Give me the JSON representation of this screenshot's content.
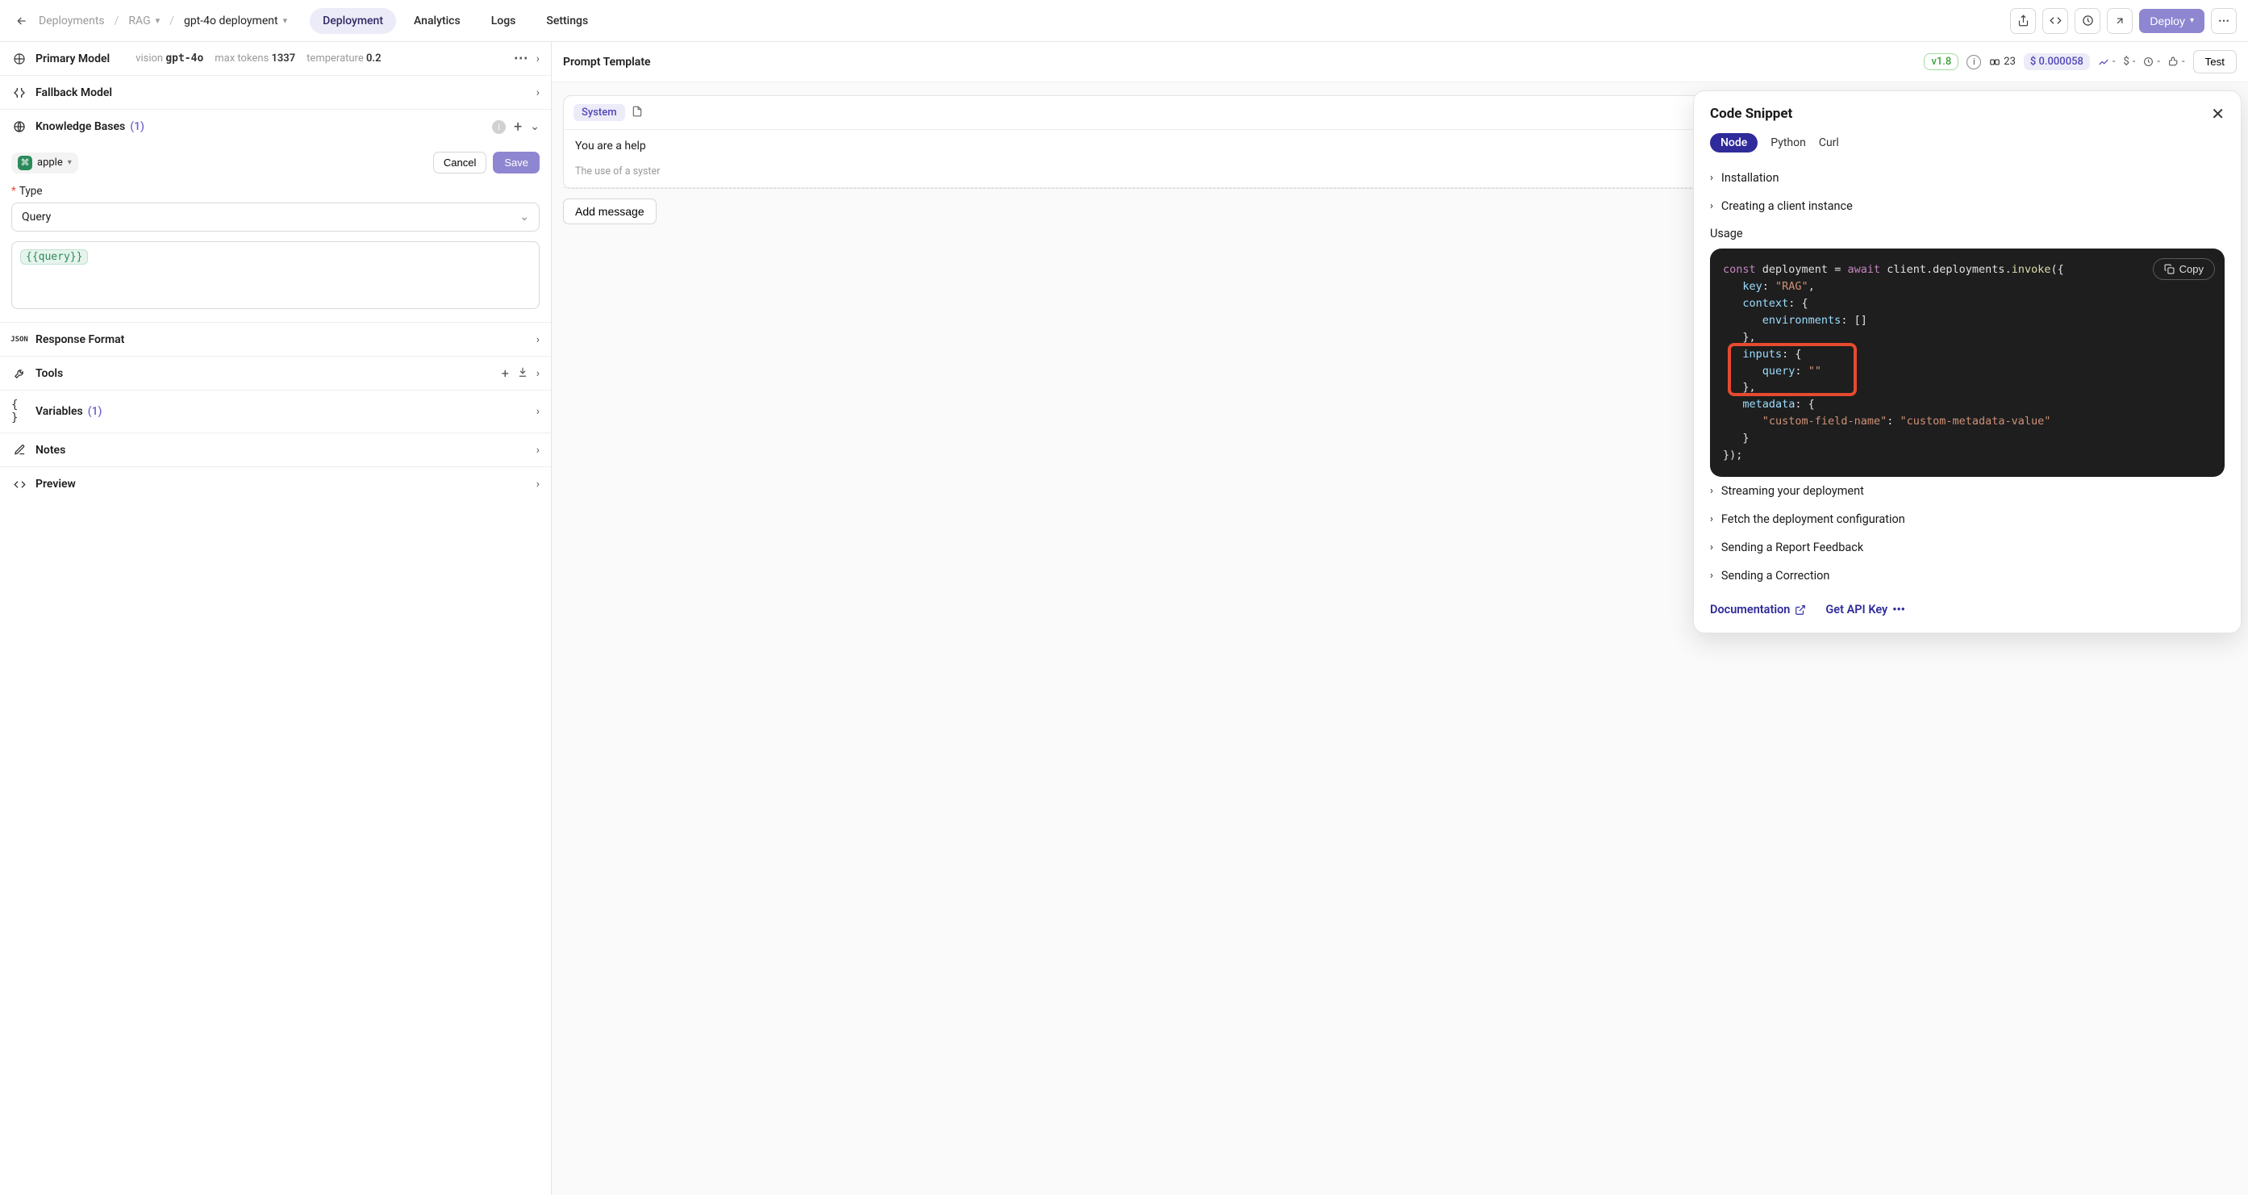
{
  "breadcrumbs": {
    "root": "Deployments",
    "project": "RAG",
    "deployment": "gpt-4o deployment"
  },
  "top_tabs": {
    "deployment": "Deployment",
    "analytics": "Analytics",
    "logs": "Logs",
    "settings": "Settings"
  },
  "top_actions": {
    "deploy": "Deploy"
  },
  "model": {
    "header": "Primary Model",
    "vision_label": "vision",
    "vision_value": "gpt-4o",
    "max_tokens_label": "max tokens",
    "max_tokens_value": "1337",
    "temperature_label": "temperature",
    "temperature_value": "0.2"
  },
  "fallback": {
    "header": "Fallback Model"
  },
  "kb": {
    "header": "Knowledge Bases",
    "count": "(1)",
    "chip": "apple",
    "cancel": "Cancel",
    "save": "Save",
    "type_label": "Type",
    "type_value": "Query",
    "query_chip": "{{query}}"
  },
  "sections": {
    "response_format": "Response Format",
    "tools": "Tools",
    "variables": "Variables",
    "variables_count": "(1)",
    "notes": "Notes",
    "preview": "Preview"
  },
  "prompt": {
    "header": "Prompt Template",
    "version": "v1.8",
    "tokens": "23",
    "cost": "$ 0.000058",
    "dash": "-",
    "test": "Test",
    "system_pill": "System",
    "system_line": "You are a help",
    "system_note": "The use of a syster",
    "add_message": "Add message"
  },
  "snippet": {
    "title": "Code Snippet",
    "tabs": {
      "node": "Node",
      "python": "Python",
      "curl": "Curl"
    },
    "acc": {
      "installation": "Installation",
      "creating": "Creating a client instance",
      "usage": "Usage",
      "streaming": "Streaming your deployment",
      "fetch": "Fetch the deployment configuration",
      "report": "Sending a Report Feedback",
      "correction": "Sending a Correction"
    },
    "copy": "Copy",
    "footer": {
      "docs": "Documentation",
      "api_key": "Get API Key"
    },
    "code": {
      "l1a": "const",
      "l1b": "deployment",
      "l1c": "=",
      "l1d": "await",
      "l1e": "client.deployments.",
      "l1f": "invoke",
      "l1g": "({",
      "l2a": "key",
      "l2b": ": ",
      "l2c": "\"RAG\"",
      "l2d": ",",
      "l3a": "context",
      "l3b": ": {",
      "l4a": "environments",
      "l4b": ": []",
      "l5a": "},",
      "l6a": "inputs",
      "l6b": ": {",
      "l7a": "query",
      "l7b": ": ",
      "l7c": "\"\"",
      "l8a": "},",
      "l9a": "metadata",
      "l9b": ": {",
      "l10a": "\"custom-field-name\"",
      "l10b": ": ",
      "l10c": "\"custom-metadata-value\"",
      "l11a": "}",
      "l12a": "});"
    }
  }
}
